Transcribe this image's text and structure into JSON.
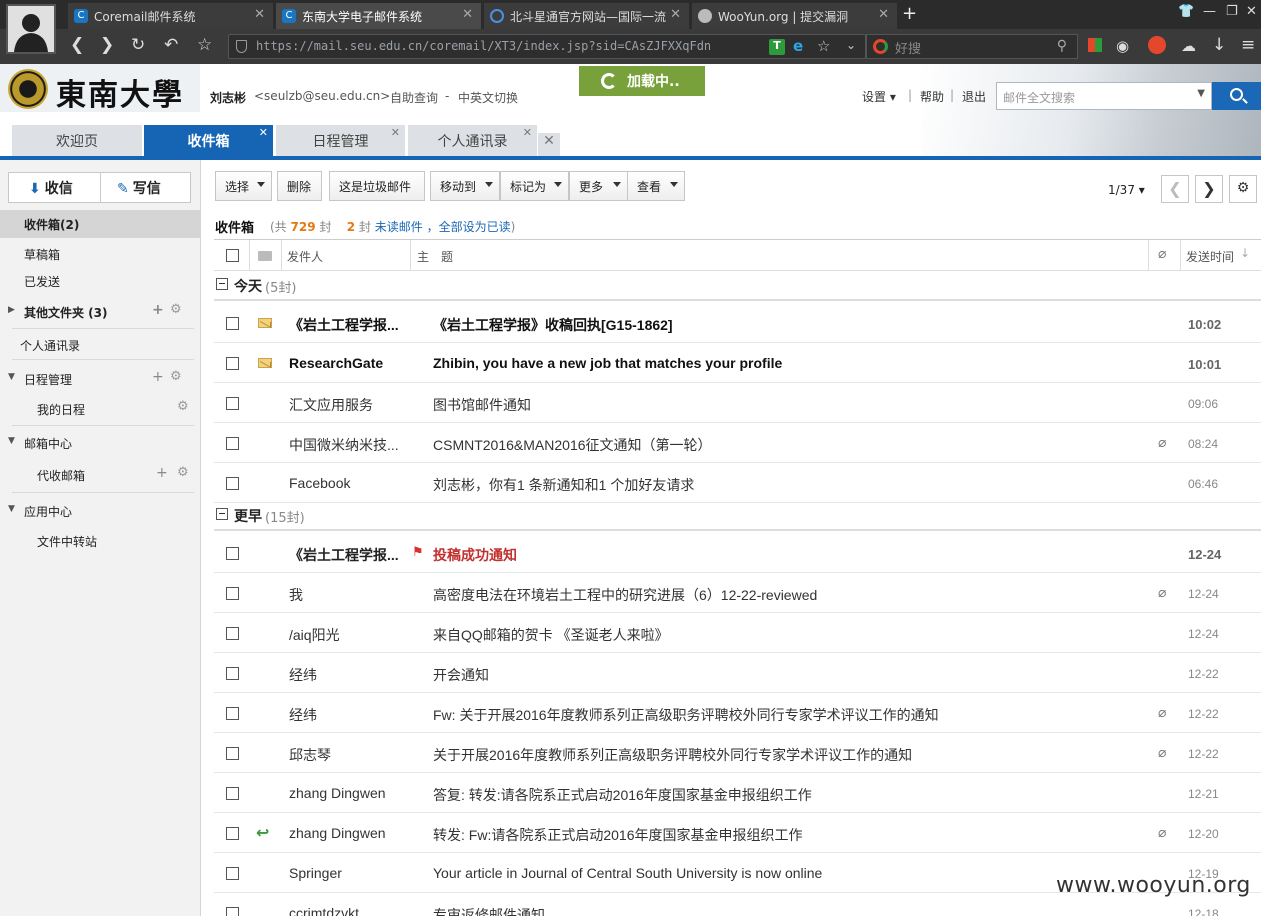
{
  "browser": {
    "tabs": [
      {
        "title": "Coremail邮件系统",
        "favicon": "C"
      },
      {
        "title": "东南大学电子邮件系统",
        "favicon": "C"
      },
      {
        "title": "北斗星通官方网站—国际一流",
        "favicon": "ring"
      },
      {
        "title": "WooYun.org | 提交漏洞",
        "favicon": "cloud"
      }
    ],
    "url": "https://mail.seu.edu.cn/coremail/XT3/index.jsp?sid=CAsZJFXXqFdn",
    "search_placeholder": "好搜"
  },
  "header": {
    "logo_text": "東南大學",
    "user_name": "刘志彬",
    "user_email": "<seulzb@seu.edu.cn>",
    "help_query": "自助查询",
    "separator": "-",
    "lang_switch": "中英文切换",
    "loading": "加载中..",
    "settings": "设置 ▾",
    "help": "帮助",
    "logout": "退出",
    "pipe": "|",
    "search_placeholder": "邮件全文搜索"
  },
  "mail_tabs": [
    {
      "label": "欢迎页",
      "active": false
    },
    {
      "label": "收件箱",
      "active": true
    },
    {
      "label": "日程管理",
      "active": false
    },
    {
      "label": "个人通讯录",
      "active": false
    }
  ],
  "sidebar": {
    "receive": "收信",
    "compose": "写信",
    "items": [
      {
        "label": "收件箱(2)"
      },
      {
        "label": "草稿箱"
      },
      {
        "label": "已发送"
      },
      {
        "label": "其他文件夹 (3)"
      },
      {
        "label": "个人通讯录"
      },
      {
        "label": "日程管理"
      },
      {
        "label": "我的日程"
      },
      {
        "label": "邮箱中心"
      },
      {
        "label": "代收邮箱"
      },
      {
        "label": "应用中心"
      },
      {
        "label": "文件中转站"
      }
    ]
  },
  "toolbar": {
    "select": "选择",
    "delete": "删除",
    "spam": "这是垃圾邮件",
    "move": "移动到",
    "mark": "标记为",
    "more": "更多",
    "view": "查看",
    "pager": "1/37 ▾"
  },
  "inbox": {
    "title": "收件箱",
    "total_prefix": "(共",
    "total_count": "729",
    "total_suffix": "封",
    "unread_count": "2",
    "unread_suffix": "封",
    "unread_link": "未读邮件",
    "mark_all_read": "，全部设为已读",
    "close_paren": ")"
  },
  "columns": {
    "sender": "发件人",
    "subject": "主　题",
    "time": "发送时间"
  },
  "groups": [
    {
      "label": "今天",
      "count": "(5封)"
    },
    {
      "label": "更早",
      "count": "(15封)"
    }
  ],
  "emails_today": [
    {
      "sender": "《岩土工程学报...",
      "subject": "《岩土工程学报》收稿回执[G15-1862]",
      "time": "10:02",
      "state": "unread"
    },
    {
      "sender": "ResearchGate",
      "subject": "Zhibin, you have a new job that matches your profile",
      "time": "10:01",
      "state": "unread"
    },
    {
      "sender": "汇文应用服务",
      "subject": "图书馆邮件通知",
      "time": "09:06",
      "state": "read"
    },
    {
      "sender": "中国微米纳米技...",
      "subject": "CSMNT2016&MAN2016征文通知（第一轮）",
      "time": "08:24",
      "state": "read",
      "attachment": true
    },
    {
      "sender": "Facebook",
      "subject": "刘志彬，你有1 条新通知和1 个加好友请求",
      "time": "06:46",
      "state": "read"
    }
  ],
  "emails_earlier": [
    {
      "sender": "《岩土工程学报...",
      "subject": "投稿成功通知",
      "time": "12-24",
      "state": "important"
    },
    {
      "sender": "我",
      "subject": "高密度电法在环境岩土工程中的研究进展（6）12-22-reviewed",
      "time": "12-24",
      "state": "read",
      "attachment": true
    },
    {
      "sender": "/aiq阳光",
      "subject": "来自QQ邮箱的贺卡 《圣诞老人来啦》",
      "time": "12-24",
      "state": "read"
    },
    {
      "sender": "经纬",
      "subject": "开会通知",
      "time": "12-22",
      "state": "read"
    },
    {
      "sender": "经纬",
      "subject": "Fw: 关于开展2016年度教师系列正高级职务评聘校外同行专家学术评议工作的通知",
      "time": "12-22",
      "state": "read",
      "attachment": true
    },
    {
      "sender": "邱志琴",
      "subject": "关于开展2016年度教师系列正高级职务评聘校外同行专家学术评议工作的通知",
      "time": "12-22",
      "state": "read",
      "attachment": true
    },
    {
      "sender": "zhang Dingwen",
      "subject": "答复: 转发:请各院系正式启动2016年度国家基金申报组织工作",
      "time": "12-21",
      "state": "read"
    },
    {
      "sender": "zhang Dingwen",
      "subject": "转发: Fw:请各院系正式启动2016年度国家基金申报组织工作",
      "time": "12-20",
      "state": "replied",
      "attachment": true
    },
    {
      "sender": "Springer",
      "subject": "Your article in Journal of Central South University is now online",
      "time": "12-19",
      "state": "read"
    },
    {
      "sender": "ccrimtdzvkt",
      "subject": "专审返修邮件通知",
      "time": "12-18",
      "state": "read"
    }
  ],
  "watermark": "www.wooyun.org",
  "colors": {
    "primary": "#1565b4",
    "loading": "#79a13b",
    "important": "#c0302e",
    "count": "#e47911"
  }
}
